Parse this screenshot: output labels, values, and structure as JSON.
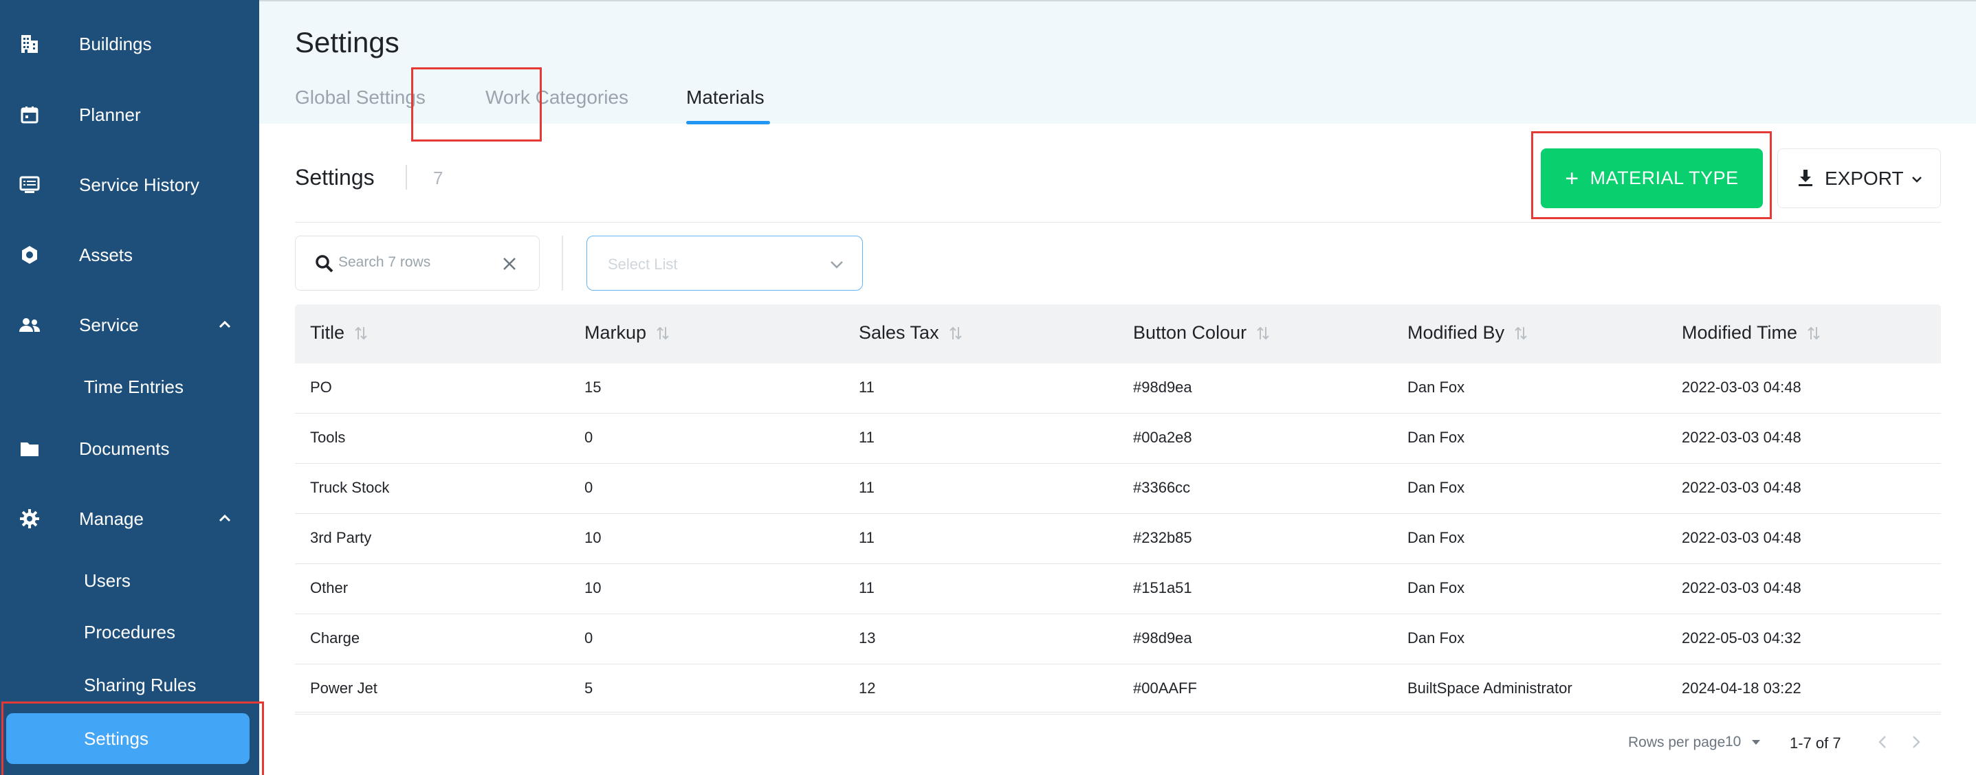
{
  "sidebar": {
    "items": [
      {
        "label": "Buildings",
        "icon": "building-icon"
      },
      {
        "label": "Planner",
        "icon": "calendar-icon"
      },
      {
        "label": "Service History",
        "icon": "list-icon"
      },
      {
        "label": "Assets",
        "icon": "hexagon-icon"
      },
      {
        "label": "Service",
        "icon": "people-icon"
      },
      {
        "label": "Documents",
        "icon": "folder-icon"
      },
      {
        "label": "Manage",
        "icon": "gear-icon"
      }
    ],
    "service_sub": [
      {
        "label": "Time Entries"
      }
    ],
    "manage_sub": [
      {
        "label": "Users"
      },
      {
        "label": "Procedures"
      },
      {
        "label": "Sharing Rules"
      },
      {
        "label": "Settings"
      }
    ]
  },
  "header": {
    "title": "Settings",
    "tabs": [
      {
        "label": "Global Settings"
      },
      {
        "label": "Work Categories"
      },
      {
        "label": "Materials"
      }
    ],
    "active_tab": "Materials"
  },
  "toolbar": {
    "title": "Settings",
    "count": "7",
    "add_label": "MATERIAL TYPE",
    "export_label": "EXPORT",
    "search_placeholder": "Search 7 rows",
    "select_placeholder": "Select List"
  },
  "table": {
    "columns": [
      "Title",
      "Markup",
      "Sales Tax",
      "Button Colour",
      "Modified By",
      "Modified Time"
    ],
    "rows": [
      [
        "PO",
        "15",
        "11",
        "#98d9ea",
        "Dan Fox",
        "2022-03-03 04:48"
      ],
      [
        "Tools",
        "0",
        "11",
        "#00a2e8",
        "Dan Fox",
        "2022-03-03 04:48"
      ],
      [
        "Truck Stock",
        "0",
        "11",
        "#3366cc",
        "Dan Fox",
        "2022-03-03 04:48"
      ],
      [
        "3rd Party",
        "10",
        "11",
        "#232b85",
        "Dan Fox",
        "2022-03-03 04:48"
      ],
      [
        "Other",
        "10",
        "11",
        "#151a51",
        "Dan Fox",
        "2022-03-03 04:48"
      ],
      [
        "Charge",
        "0",
        "13",
        "#98d9ea",
        "Dan Fox",
        "2022-05-03 04:32"
      ],
      [
        "Power Jet",
        "5",
        "12",
        "#00AAFF",
        "BuiltSpace Administrator",
        "2024-04-18 03:22"
      ]
    ]
  },
  "pagination": {
    "rows_per_page_label": "Rows per page",
    "rows_per_page_value": "10",
    "range": "1-7 of 7"
  },
  "colors": {
    "sidebar_bg": "#1e4f7a",
    "active_item": "#42a5f5",
    "primary_button": "#0acf6e",
    "tab_underline": "#2196f3",
    "highlight": "#e53935"
  }
}
